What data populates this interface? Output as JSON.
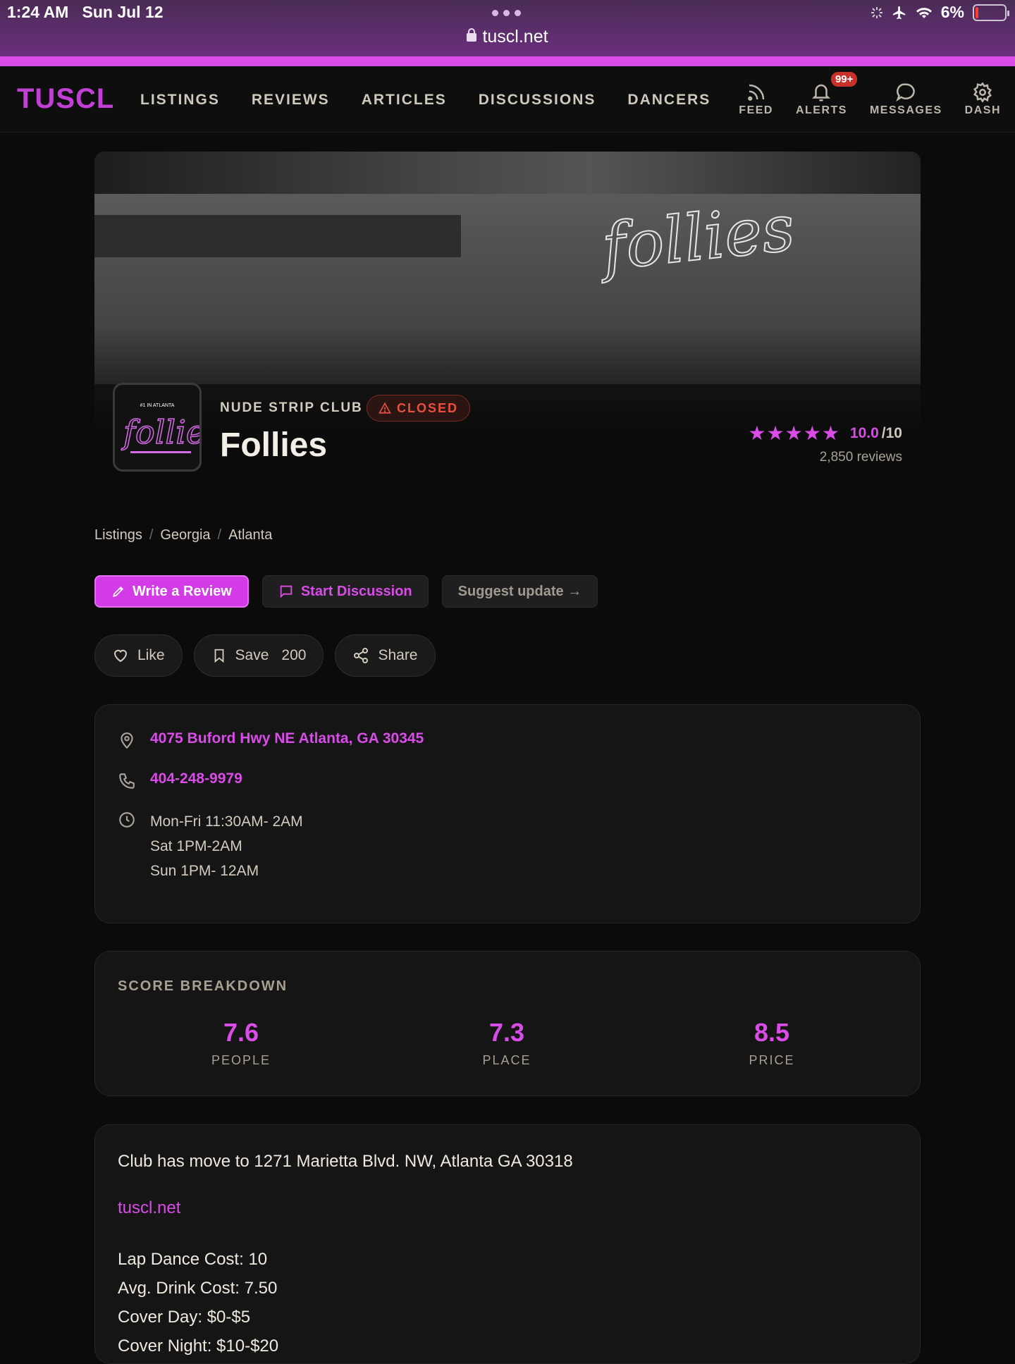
{
  "status_bar": {
    "time": "1:24 AM",
    "date": "Sun Jul 12",
    "battery": "6%"
  },
  "browser": {
    "url": "tuscl.net"
  },
  "nav": {
    "logo": "TUSCL",
    "links": [
      "LISTINGS",
      "REVIEWS",
      "ARTICLES",
      "DISCUSSIONS",
      "DANCERS"
    ],
    "icons": [
      {
        "label": "FEED",
        "icon": "rss-icon"
      },
      {
        "label": "ALERTS",
        "icon": "bell-icon",
        "badge": "99+"
      },
      {
        "label": "MESSAGES",
        "icon": "chat-bubble-icon"
      },
      {
        "label": "DASH",
        "icon": "gear-icon"
      }
    ]
  },
  "club": {
    "logo_tagline": "#1 IN ATLANTA",
    "logo_word": "follies",
    "hero_sign": "follies",
    "type": "NUDE STRIP CLUB",
    "status": "CLOSED",
    "name": "Follies",
    "stars": "★★★★★",
    "rating": "10.0",
    "rating_out_of": "/10",
    "review_count": "2,850 reviews"
  },
  "breadcrumb": [
    "Listings",
    "Georgia",
    "Atlanta"
  ],
  "actions": {
    "write_review": "Write a Review",
    "start_discussion": "Start Discussion",
    "suggest_update": "Suggest update →"
  },
  "social": {
    "like": "Like",
    "save": "Save",
    "save_count": "200",
    "share": "Share"
  },
  "info": {
    "address": "4075 Buford Hwy NE Atlanta, GA 30345",
    "phone": "404-248-9979",
    "hours": [
      "Mon-Fri 11:30AM- 2AM",
      "Sat 1PM-2AM",
      "Sun 1PM- 12AM"
    ]
  },
  "scores": {
    "title": "SCORE BREAKDOWN",
    "items": [
      {
        "value": "7.6",
        "label": "PEOPLE"
      },
      {
        "value": "7.3",
        "label": "PLACE"
      },
      {
        "value": "8.5",
        "label": "PRICE"
      }
    ]
  },
  "description": {
    "notice": "Club has move to 1271 Marietta Blvd. NW, Atlanta GA 30318",
    "link": "tuscl.net",
    "details": [
      "Lap Dance Cost: 10",
      "Avg. Drink Cost: 7.50",
      "Cover Day: $0-$5",
      "Cover Night: $10-$20"
    ]
  },
  "colors": {
    "accent": "#d94ce8",
    "closed": "#e8503f",
    "background": "#0b0b0b"
  }
}
